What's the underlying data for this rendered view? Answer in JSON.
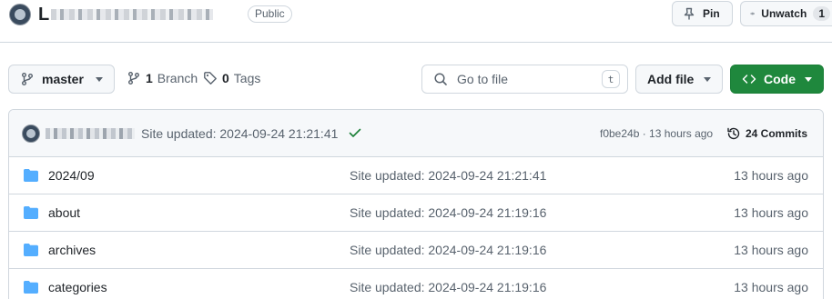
{
  "repo": {
    "name_prefix": "L",
    "visibility": "Public",
    "pin_label": "Pin",
    "watch_label": "Unwatch",
    "watch_count": "1"
  },
  "toolbar": {
    "branch": "master",
    "branches_count": "1",
    "branches_label": "Branch",
    "tags_count": "0",
    "tags_label": "Tags",
    "search_placeholder": "Go to file",
    "search_shortcut": "t",
    "add_file_label": "Add file",
    "code_label": "Code"
  },
  "commit": {
    "message": "Site updated: 2024-09-24 21:21:41",
    "meta": "f0be24b · 13 hours ago",
    "commits_count": "24 Commits",
    "status_color": "#1a7f37"
  },
  "files": [
    {
      "name": "2024/09",
      "message": "Site updated: 2024-09-24 21:21:41",
      "age": "13 hours ago"
    },
    {
      "name": "about",
      "message": "Site updated: 2024-09-24 21:19:16",
      "age": "13 hours ago"
    },
    {
      "name": "archives",
      "message": "Site updated: 2024-09-24 21:19:16",
      "age": "13 hours ago"
    },
    {
      "name": "categories",
      "message": "Site updated: 2024-09-24 21:19:16",
      "age": "13 hours ago"
    }
  ],
  "icons": {
    "folder": "folder-icon",
    "branch": "git-branch-icon",
    "tag": "tag-icon",
    "search": "search-icon",
    "pin": "pin-icon",
    "eye": "eye-icon",
    "code": "code-icon",
    "history": "history-icon",
    "check": "check-icon"
  },
  "colors": {
    "accent_green": "#1f883d",
    "folder_blue": "#54aeff",
    "border": "#d0d7de",
    "muted": "#59636e"
  }
}
